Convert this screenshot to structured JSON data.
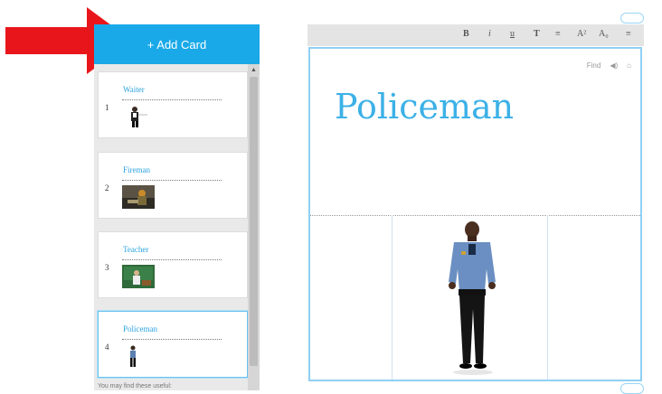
{
  "toolbar": {
    "add_card_label": "+ Add Card",
    "bold": "B",
    "italic": "i",
    "underline": "u",
    "text_style": "T",
    "list": "≡",
    "superscript": "A²",
    "subscript": "A₀",
    "more": "≡"
  },
  "cards": [
    {
      "number": "1",
      "title": "Waiter"
    },
    {
      "number": "2",
      "title": "Fireman"
    },
    {
      "number": "3",
      "title": "Teacher"
    },
    {
      "number": "4",
      "title": "Policeman"
    }
  ],
  "footnote": "You may find these useful:",
  "editor": {
    "title": "Policeman",
    "ctrl_find": "Find",
    "ctrl_audio": "◀)",
    "ctrl_image": "⌂"
  },
  "colors": {
    "accent": "#1aa9e8",
    "title_text": "#3cb1e7",
    "arrow": "#e8161b"
  }
}
